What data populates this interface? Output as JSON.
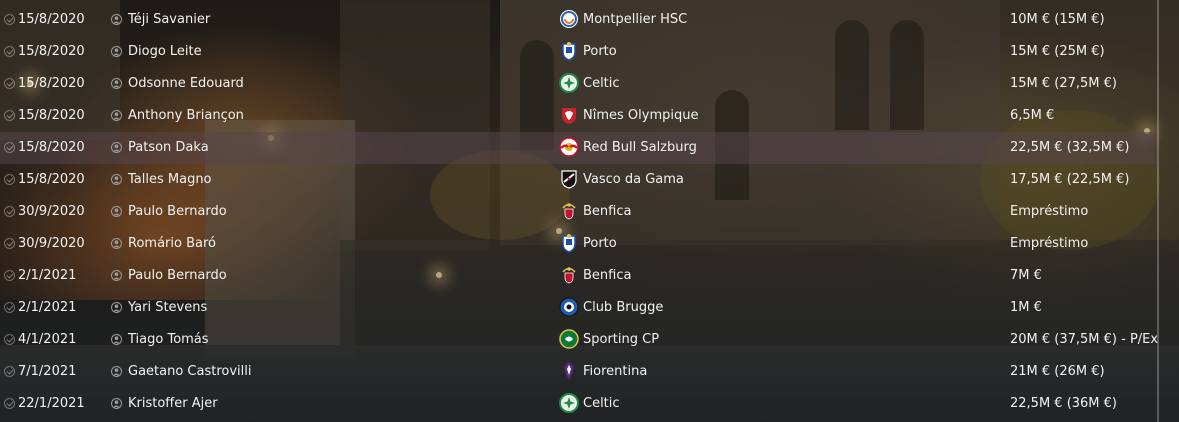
{
  "transfers": [
    {
      "date": "15/8/2020",
      "player": "Téji Savanier",
      "club": "Montpellier HSC",
      "club_icon": "montpellier-crest-icon",
      "fee": "10M € (15M €)"
    },
    {
      "date": "15/8/2020",
      "player": "Diogo Leite",
      "club": "Porto",
      "club_icon": "porto-crest-icon",
      "fee": "15M € (25M €)"
    },
    {
      "date": "15/8/2020",
      "player": "Odsonne Edouard",
      "club": "Celtic",
      "club_icon": "celtic-crest-icon",
      "fee": "15M € (27,5M €)"
    },
    {
      "date": "15/8/2020",
      "player": "Anthony Briançon",
      "club": "Nîmes Olympique",
      "club_icon": "nimes-crest-icon",
      "fee": "6,5M €"
    },
    {
      "date": "15/8/2020",
      "player": "Patson Daka",
      "club": "Red Bull Salzburg",
      "club_icon": "salzburg-crest-icon",
      "fee": "22,5M € (32,5M €)"
    },
    {
      "date": "15/8/2020",
      "player": "Talles Magno",
      "club": "Vasco da Gama",
      "club_icon": "vasco-crest-icon",
      "fee": "17,5M € (22,5M €)"
    },
    {
      "date": "30/9/2020",
      "player": "Paulo Bernardo",
      "club": "Benfica",
      "club_icon": "benfica-crest-icon",
      "fee": "Empréstimo"
    },
    {
      "date": "30/9/2020",
      "player": "Romário Baró",
      "club": "Porto",
      "club_icon": "porto-crest-icon",
      "fee": "Empréstimo"
    },
    {
      "date": "2/1/2021",
      "player": "Paulo Bernardo",
      "club": "Benfica",
      "club_icon": "benfica-crest-icon",
      "fee": "7M €"
    },
    {
      "date": "2/1/2021",
      "player": "Yari Stevens",
      "club": "Club Brugge",
      "club_icon": "brugge-crest-icon",
      "fee": "1M €"
    },
    {
      "date": "4/1/2021",
      "player": "Tiago Tomás",
      "club": "Sporting CP",
      "club_icon": "sporting-crest-icon",
      "fee": "20M € (37,5M €) - P/Ex"
    },
    {
      "date": "7/1/2021",
      "player": "Gaetano Castrovilli",
      "club": "Fiorentina",
      "club_icon": "fiorentina-crest-icon",
      "fee": "21M € (26M €)"
    },
    {
      "date": "22/1/2021",
      "player": "Kristoffer Ajer",
      "club": "Celtic",
      "club_icon": "celtic-crest-icon",
      "fee": "22,5M € (36M €)"
    }
  ],
  "selected_row_index": 4,
  "colors": {
    "text": "#f2f2f2",
    "selected_row": "#55464b"
  }
}
